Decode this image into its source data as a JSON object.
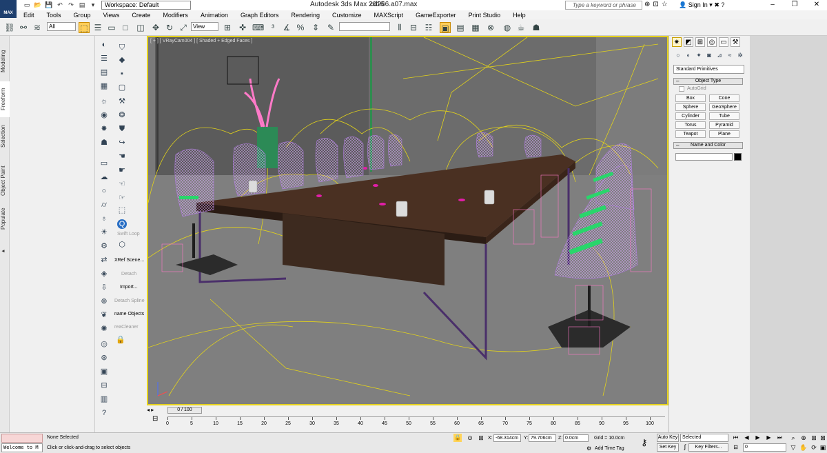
{
  "title_bar": {
    "logo_text": "MAX",
    "workspace": "Workspace: Default",
    "app_title": "Autodesk 3ds Max 2016",
    "file_name": "cd266.a07.max",
    "search_placeholder": "Type a keyword or phrase",
    "sign_in": "Sign In",
    "window_buttons": [
      "–",
      "❐",
      "✕"
    ]
  },
  "menu": [
    "Edit",
    "Tools",
    "Group",
    "Views",
    "Create",
    "Modifiers",
    "Animation",
    "Graph Editors",
    "Rendering",
    "Customize",
    "MAXScript",
    "GameExporter",
    "Print Studio",
    "Help"
  ],
  "toolbar": {
    "selection_filter": "All",
    "ref_coord": "View",
    "named_selection": ""
  },
  "ribbon_tabs": [
    "Modeling",
    "Freeform",
    "Selection",
    "Object Paint",
    "Populate"
  ],
  "left_panel": {
    "labels": {
      "swift_loop": "Swift Loop",
      "xref": "XRef Scene...",
      "detach": "Detach",
      "import": "Import...",
      "detach_splines": "Detach Spline",
      "rename": "name Objects",
      "cleaner": "reaCleaner"
    }
  },
  "viewport": {
    "label": "[ + ] [ VRayCam004 ] [ Shaded + Edged Faces ]"
  },
  "command_panel": {
    "dropdown": "Standard Primitives",
    "object_type_title": "Object Type",
    "autogrid": "AutoGrid",
    "primitives": [
      "Box",
      "Cone",
      "Sphere",
      "GeoSphere",
      "Cylinder",
      "Tube",
      "Torus",
      "Pyramid",
      "Teapot",
      "Plane"
    ],
    "name_color_title": "Name and Color"
  },
  "timeline": {
    "slider": "0 / 100",
    "ticks": [
      0,
      5,
      10,
      15,
      20,
      25,
      30,
      35,
      40,
      45,
      50,
      55,
      60,
      65,
      70,
      75,
      80,
      85,
      90,
      95,
      100
    ]
  },
  "status": {
    "welcome": "Welcome to M",
    "selection": "None Selected",
    "prompt": "Click or click-and-drag to select objects",
    "x_label": "X:",
    "x_value": "-68.314cm",
    "y_label": "Y:",
    "y_value": "79.706cm",
    "z_label": "Z:",
    "z_value": "0.0cm",
    "grid": "Grid = 10.0cm",
    "add_time_tag": "Add Time Tag",
    "auto_key": "Auto Key",
    "set_key": "Set Key",
    "key_mode": "Selected",
    "key_filters": "Key Filters...",
    "frame": "0"
  }
}
